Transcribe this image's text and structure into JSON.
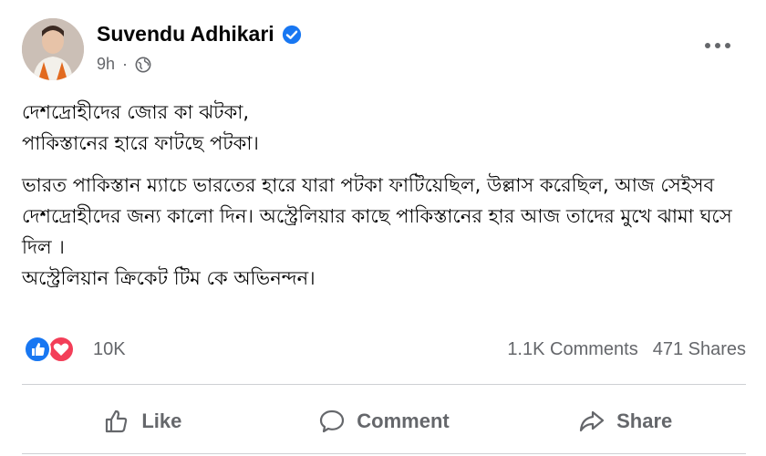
{
  "post": {
    "author": "Suvendu Adhikari",
    "time": "9h",
    "separator": "·",
    "paragraphs": [
      "দেশদ্রোহীদের জোর কা ঝটকা,\nপাকিস্তানের হারে ফাটছে পটকা।",
      "ভারত পাকিস্তান ম্যাচে ভারতের হারে যারা পটকা ফাটিয়েছিল, উল্লাস করেছিল, আজ সেইসব দেশদ্রোহীদের জন্য কালো দিন। অস্ট্রেলিয়ার কাছে পাকিস্তানের হার আজ তাদের মুখে ঝামা ঘসে দিল ।\nঅস্ট্রেলিয়ান ক্রিকেট টিম কে অভিনন্দন।"
    ]
  },
  "engagement": {
    "reactions_count": "10K",
    "comments": "1.1K Comments",
    "shares": "471 Shares"
  },
  "actions": {
    "like": "Like",
    "comment": "Comment",
    "share": "Share"
  },
  "icons": {
    "verified": "verified-badge-icon",
    "audience": "globe-icon",
    "more": "more-options-icon",
    "like_reaction": "like-reaction-icon",
    "love_reaction": "love-reaction-icon"
  },
  "colors": {
    "brand_blue": "#1877f2",
    "love_red": "#f33e58",
    "secondary_text": "#65676b"
  }
}
